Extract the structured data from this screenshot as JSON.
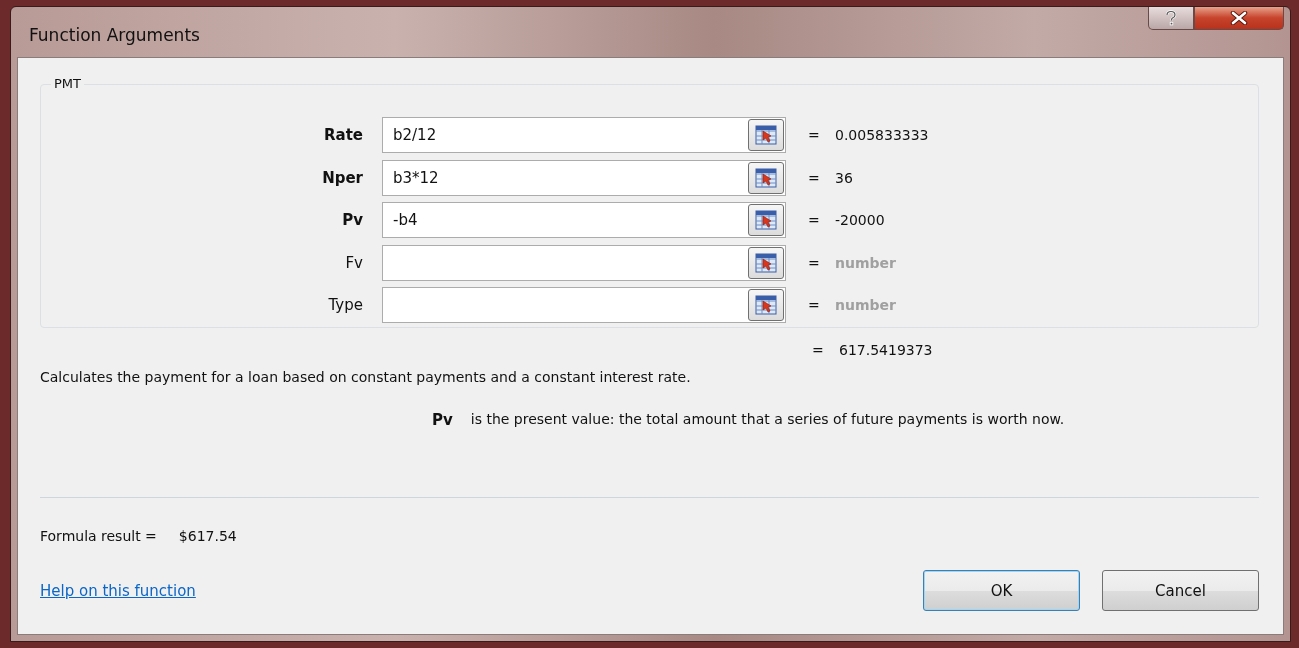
{
  "window": {
    "title": "Function Arguments",
    "buttons": [
      {
        "kind": "help"
      },
      {
        "kind": "close"
      }
    ]
  },
  "function_group": {
    "title": "PMT",
    "arguments": [
      {
        "label": "Rate",
        "required": true,
        "value": "b2/12",
        "result": "0.005833333",
        "result_hint": false
      },
      {
        "label": "Nper",
        "required": true,
        "value": "b3*12",
        "result": "36",
        "result_hint": false
      },
      {
        "label": "Pv",
        "required": true,
        "value": "-b4",
        "result": "-20000",
        "result_hint": false
      },
      {
        "label": "Fv",
        "required": false,
        "result": "number",
        "result_hint": true
      },
      {
        "label": "Type",
        "required": false,
        "result": "number",
        "result_hint": true
      }
    ]
  },
  "equals": "=",
  "total_result": "617.5419373",
  "description": "Calculates the payment for a loan based on constant payments and a constant interest rate.",
  "argument_help": {
    "name": "Pv",
    "text": "is the present value: the total amount that a series of future payments is worth now."
  },
  "formula_result": {
    "label": "Formula result =",
    "value": "$617.54"
  },
  "help_link": "Help on this function",
  "buttons": [
    {
      "label": "OK",
      "default": true
    },
    {
      "label": "Cancel",
      "default": false
    }
  ]
}
